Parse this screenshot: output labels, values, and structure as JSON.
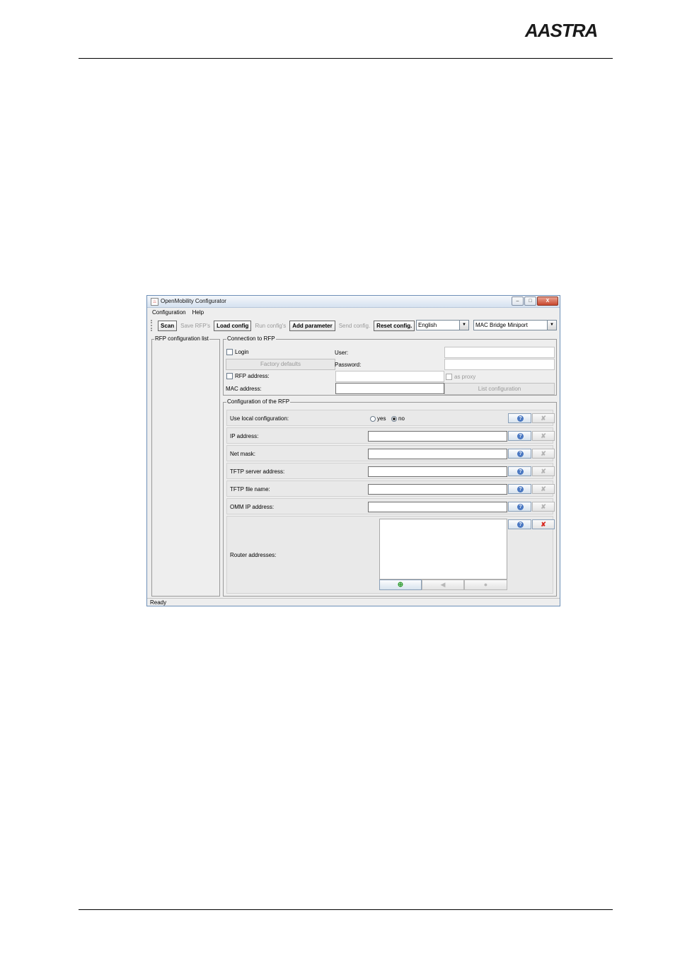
{
  "page": {
    "logo_text": "AASTRA"
  },
  "window": {
    "title": "OpenMobility Configurator",
    "buttons": {
      "minimize": "–",
      "maximize": "□",
      "close": "X"
    }
  },
  "menu": {
    "items": [
      "Configuration",
      "Help"
    ]
  },
  "toolbar": {
    "scan": "Scan",
    "save_rfps": "Save RFP's",
    "load_config": "Load config",
    "run_configs": "Run config's",
    "add_parameter": "Add parameter",
    "send_config": "Send config.",
    "reset_config": "Reset config.",
    "language": "English",
    "interface": "MAC Bridge Miniport"
  },
  "left_panel": {
    "title": "RFP configuration list"
  },
  "connection": {
    "title": "Connection to RFP",
    "login_label": "Login",
    "user_label": "User:",
    "user_value": "",
    "password_label": "Password:",
    "password_value": "",
    "factory_defaults": "Factory defaults",
    "rfp_address_label": "RFP address:",
    "rfp_address_value": "",
    "as_proxy_label": "as proxy",
    "mac_address_label": "MAC address:",
    "mac_address_value": "",
    "list_configuration": "List configuration"
  },
  "rfp_config": {
    "title": "Configuration of the RFP",
    "use_local_label": "Use local configuration:",
    "yes_label": "yes",
    "no_label": "no",
    "selected": "no",
    "ip_address_label": "IP address:",
    "ip_address_value": "",
    "net_mask_label": "Net mask:",
    "net_mask_value": "",
    "tftp_server_label": "TFTP server address:",
    "tftp_server_value": "",
    "tftp_file_label": "TFTP file name:",
    "tftp_file_value": "",
    "omm_ip_label": "OMM IP address:",
    "omm_ip_value": "",
    "router_label": "Router addresses:"
  },
  "status": {
    "text": "Ready"
  }
}
